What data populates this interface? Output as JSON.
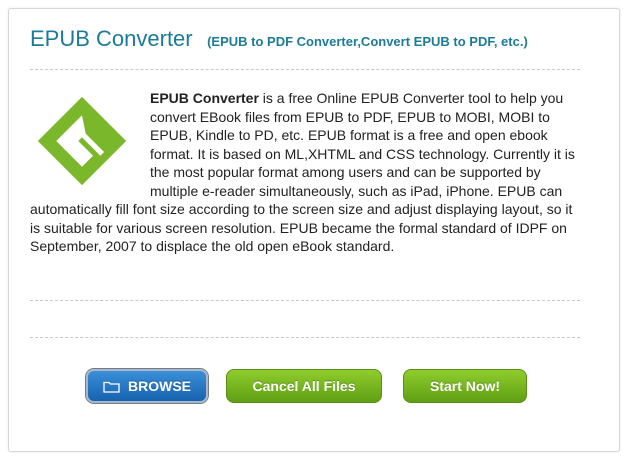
{
  "header": {
    "title": "EPUB Converter",
    "subtitle": "(EPUB to PDF Converter,Convert EPUB to PDF, etc.)"
  },
  "description": {
    "bold_lead": "EPUB Converter",
    "text": " is a free Online EPUB Converter tool to help you convert EBook files from EPUB to PDF, EPUB to MOBI, MOBI to EPUB, Kindle to PD, etc. EPUB format is a free and open ebook format. It is based on ML,XHTML and CSS technology. Currently it is the most popular format among users and can be supported by multiple e-reader simultaneously, such as iPad, iPhone. EPUB can automatically fill font size according to the screen size and adjust displaying layout, so it is suitable for various screen resolution. EPUB became the formal standard of IDPF on September, 2007 to displace the old open eBook standard."
  },
  "logo": {
    "icon": "epub-logo-icon",
    "color": "#7bb72a"
  },
  "buttons": {
    "browse_label": "BROWSE",
    "cancel_label": "Cancel All Files",
    "start_label": "Start Now!"
  },
  "colors": {
    "title": "#1c7b98",
    "browse": "#1f6fc0",
    "green": "#72b21d"
  }
}
